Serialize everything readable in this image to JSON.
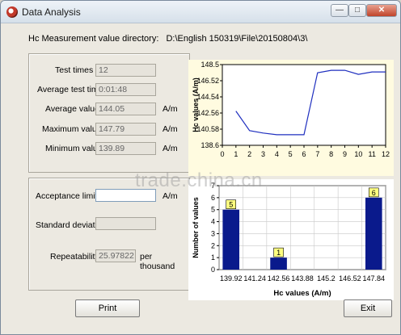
{
  "window": {
    "title": "Data Analysis",
    "min_label": "—",
    "max_label": "□",
    "close_label": "✕"
  },
  "directory": {
    "label": "Hc Measurement value directory:",
    "path": "D:\\English 150319\\File\\20150804\\3\\"
  },
  "stats": {
    "test_times_label": "Test times",
    "test_times_value": "12",
    "avg_test_time_label": "Average test time",
    "avg_test_time_value": "0:01:48",
    "avg_value_label": "Average value",
    "avg_value": "144.05",
    "max_value_label": "Maximum value",
    "max_value": "147.79",
    "min_value_label": "Minimum value",
    "min_value": "139.89",
    "unit": "A/m"
  },
  "acceptance": {
    "limits_label": "Acceptance limits",
    "limits_value": "",
    "limits_unit": "A/m",
    "std_dev_label": "Standard deviation",
    "std_dev_value": "",
    "repeatability_label": "Repeatability",
    "repeatability_value": "25.97822",
    "repeatability_unit": "per thousand"
  },
  "buttons": {
    "print": "Print",
    "exit": "Exit"
  },
  "watermark": "trade.china.cn",
  "chart_data": [
    {
      "type": "line",
      "ylabel": "Hc values (A/m)",
      "xlabel": "",
      "y_ticks": [
        "148.5",
        "146.52",
        "144.54",
        "142.56",
        "140.58",
        "138.6"
      ],
      "ylim": [
        138.6,
        148.5
      ],
      "x_ticks": [
        "0",
        "1",
        "2",
        "3",
        "4",
        "5",
        "6",
        "7",
        "8",
        "9",
        "10",
        "11",
        "12"
      ],
      "xlim": [
        0,
        12
      ],
      "x": [
        1,
        2,
        3,
        4,
        5,
        6,
        7,
        8,
        9,
        10,
        11,
        12
      ],
      "y": [
        142.8,
        140.4,
        140.1,
        139.9,
        139.9,
        139.9,
        147.5,
        147.8,
        147.8,
        147.3,
        147.6,
        147.6
      ],
      "line_color": "#1f2fbf",
      "background": "#ffffff",
      "plot_bg": "#fffbe0",
      "grid": false
    },
    {
      "type": "bar",
      "ylabel": "Number of values",
      "xlabel": "Hc values (A/m)",
      "categories": [
        "139.92",
        "141.24",
        "142.56",
        "143.88",
        "145.2",
        "146.52",
        "147.84"
      ],
      "values": [
        5,
        0,
        1,
        0,
        0,
        0,
        6
      ],
      "value_labels": [
        "5",
        "",
        "1",
        "",
        "",
        "",
        "6"
      ],
      "y_ticks": [
        "0",
        "1",
        "2",
        "3",
        "4",
        "5",
        "6",
        "7"
      ],
      "ylim": [
        0,
        7
      ],
      "bar_color": "#0a1a8c",
      "label_bg": "#ffff80",
      "grid": true
    }
  ]
}
